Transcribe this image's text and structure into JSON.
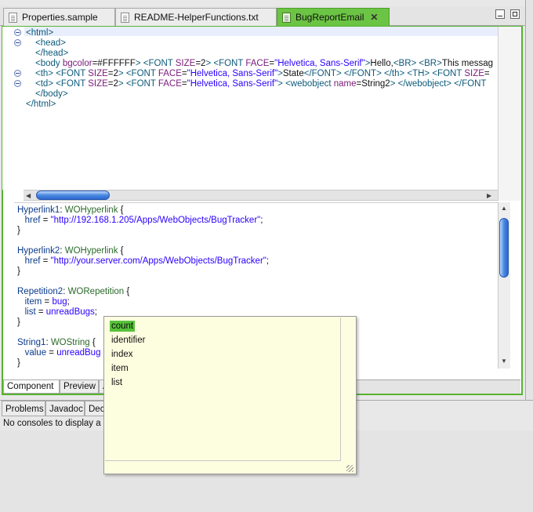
{
  "tabs": [
    {
      "label": "Properties.sample",
      "icon": "text-file-icon"
    },
    {
      "label": "README-HelperFunctions.txt",
      "icon": "text-file-icon"
    },
    {
      "label": "BugReportEmail",
      "icon": "webobjects-component-icon",
      "close": "✕"
    }
  ],
  "html_lines": [
    {
      "fold": true,
      "indent": 0,
      "parts": [
        {
          "t": "tag",
          "v": "<html>"
        }
      ]
    },
    {
      "fold": true,
      "indent": 1,
      "parts": [
        {
          "t": "tag",
          "v": "<head>"
        }
      ]
    },
    {
      "fold": false,
      "indent": 1,
      "parts": [
        {
          "t": "tag",
          "v": "</head>"
        }
      ]
    },
    {
      "fold": false,
      "indent": 1,
      "parts": [
        {
          "t": "tag",
          "v": "<body "
        },
        {
          "t": "attr",
          "v": "bgcolor"
        },
        {
          "t": "txt",
          "v": "=#FFFFFF"
        },
        {
          "t": "tag",
          "v": "> <FONT "
        },
        {
          "t": "attr",
          "v": "SIZE"
        },
        {
          "t": "txt",
          "v": "=2"
        },
        {
          "t": "tag",
          "v": "> <FONT "
        },
        {
          "t": "attr",
          "v": "FACE"
        },
        {
          "t": "txt",
          "v": "="
        },
        {
          "t": "val",
          "v": "\"Helvetica, Sans-Serif\""
        },
        {
          "t": "tag",
          "v": ">"
        },
        {
          "t": "txt",
          "v": "Hello,"
        },
        {
          "t": "tag",
          "v": "<BR> <BR>"
        },
        {
          "t": "txt",
          "v": "This messag"
        }
      ]
    },
    {
      "fold": true,
      "indent": 1,
      "parts": [
        {
          "t": "tag",
          "v": "<th> <FONT "
        },
        {
          "t": "attr",
          "v": "SIZE"
        },
        {
          "t": "txt",
          "v": "=2"
        },
        {
          "t": "tag",
          "v": "> <FONT "
        },
        {
          "t": "attr",
          "v": "FACE"
        },
        {
          "t": "txt",
          "v": "="
        },
        {
          "t": "val",
          "v": "\"Helvetica, Sans-Serif\""
        },
        {
          "t": "tag",
          "v": ">"
        },
        {
          "t": "txt",
          "v": "State"
        },
        {
          "t": "tag",
          "v": "</FONT> </FONT> </th> <TH> <FONT "
        },
        {
          "t": "attr",
          "v": "SIZE"
        },
        {
          "t": "txt",
          "v": "="
        }
      ]
    },
    {
      "fold": true,
      "indent": 1,
      "parts": [
        {
          "t": "tag",
          "v": "<td> <FONT "
        },
        {
          "t": "attr",
          "v": "SIZE"
        },
        {
          "t": "txt",
          "v": "=2"
        },
        {
          "t": "tag",
          "v": "> <FONT "
        },
        {
          "t": "attr",
          "v": "FACE"
        },
        {
          "t": "txt",
          "v": "="
        },
        {
          "t": "val",
          "v": "\"Helvetica, Sans-Serif\""
        },
        {
          "t": "tag",
          "v": "> <webobject "
        },
        {
          "t": "attr",
          "v": "name"
        },
        {
          "t": "txt",
          "v": "=String2"
        },
        {
          "t": "tag",
          "v": "> </webobject> </FONT"
        }
      ]
    },
    {
      "fold": false,
      "indent": 1,
      "parts": [
        {
          "t": "tag",
          "v": "</body>"
        }
      ]
    },
    {
      "fold": false,
      "indent": 0,
      "parts": [
        {
          "t": "tag",
          "v": "</html>"
        }
      ]
    }
  ],
  "wod_lines": [
    [
      {
        "t": "wkey",
        "v": "Hyperlink1"
      },
      {
        "t": "txt",
        "v": ": "
      },
      {
        "t": "wtype",
        "v": "WOHyperlink"
      },
      {
        "t": "txt",
        "v": " {"
      }
    ],
    [
      {
        "t": "txt",
        "v": "   "
      },
      {
        "t": "wkey",
        "v": "href"
      },
      {
        "t": "txt",
        "v": " = "
      },
      {
        "t": "wstr",
        "v": "\"http://192.168.1.205/Apps/WebObjects/BugTracker\""
      },
      {
        "t": "txt",
        "v": ";"
      }
    ],
    [
      {
        "t": "txt",
        "v": "}"
      }
    ],
    [],
    [
      {
        "t": "wkey",
        "v": "Hyperlink2"
      },
      {
        "t": "txt",
        "v": ": "
      },
      {
        "t": "wtype",
        "v": "WOHyperlink"
      },
      {
        "t": "txt",
        "v": " {"
      }
    ],
    [
      {
        "t": "txt",
        "v": "   "
      },
      {
        "t": "wkey",
        "v": "href"
      },
      {
        "t": "txt",
        "v": " = "
      },
      {
        "t": "wstr",
        "v": "\"http://your.server.com/Apps/WebObjects/BugTracker\""
      },
      {
        "t": "txt",
        "v": ";"
      }
    ],
    [
      {
        "t": "txt",
        "v": "}"
      }
    ],
    [],
    [
      {
        "t": "wkey",
        "v": "Repetition2"
      },
      {
        "t": "txt",
        "v": ": "
      },
      {
        "t": "wtype",
        "v": "WORepetition"
      },
      {
        "t": "txt",
        "v": " {"
      }
    ],
    [
      {
        "t": "txt",
        "v": "   "
      },
      {
        "t": "wkey",
        "v": "item"
      },
      {
        "t": "txt",
        "v": " = "
      },
      {
        "t": "wstr",
        "v": "bug"
      },
      {
        "t": "txt",
        "v": ";"
      }
    ],
    [
      {
        "t": "txt",
        "v": "   "
      },
      {
        "t": "wkey",
        "v": "list"
      },
      {
        "t": "txt",
        "v": " = "
      },
      {
        "t": "wstr",
        "v": "unreadBugs"
      },
      {
        "t": "txt",
        "v": ";"
      }
    ],
    [
      {
        "t": "txt",
        "v": "}"
      }
    ],
    [],
    [
      {
        "t": "wkey",
        "v": "String1"
      },
      {
        "t": "txt",
        "v": ": "
      },
      {
        "t": "wtype",
        "v": "WOString"
      },
      {
        "t": "txt",
        "v": " {"
      }
    ],
    [
      {
        "t": "txt",
        "v": "   "
      },
      {
        "t": "wkey",
        "v": "value"
      },
      {
        "t": "txt",
        "v": " = "
      },
      {
        "t": "wstr",
        "v": "unreadBug"
      }
    ],
    [
      {
        "t": "txt",
        "v": "}"
      }
    ]
  ],
  "editor_tabs": {
    "component": "Component",
    "preview": "Preview",
    "api": "A"
  },
  "console_tabs": {
    "problems": "Problems",
    "javadoc": "Javadoc",
    "declaration": "Dec"
  },
  "console_message": "No consoles to display a",
  "completion": {
    "items": [
      "count",
      "identifier",
      "index",
      "item",
      "list"
    ],
    "selected": "count"
  },
  "colors": {
    "accent_green": "#57b331",
    "selection_green": "#57c23a",
    "popup_bg": "#fdfde0"
  }
}
